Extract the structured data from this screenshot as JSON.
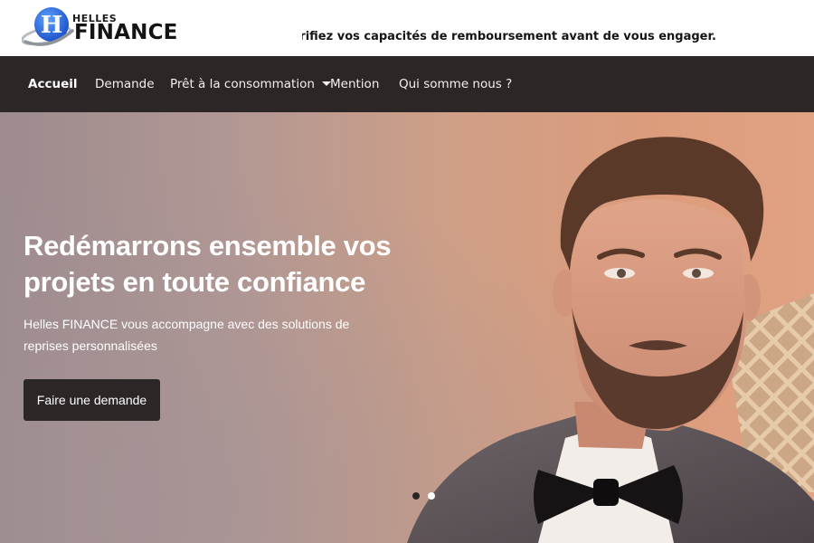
{
  "header": {
    "logo": {
      "letter": "H",
      "small": "HELLES",
      "name": "FINANCE"
    },
    "ticker": "mboursé. Vérifiez vos capacités de remboursement avant de vous engager."
  },
  "nav": {
    "items": [
      {
        "label": "Accueil",
        "active": true
      },
      {
        "label": "Demande"
      },
      {
        "label": "Prêt à la consommation",
        "dropdown": true
      },
      {
        "label": "Mention"
      },
      {
        "label": "Qui somme nous ?"
      }
    ]
  },
  "hero": {
    "title": "Redémarrons ensemble vos projets en toute confiance",
    "subtitle": "Helles FINANCE vous accompagne avec des solutions de reprises personnalisées",
    "cta": "Faire une demande",
    "slides": {
      "count": 2,
      "active": 1
    }
  },
  "colors": {
    "navbar": "#2c2627",
    "button": "#2c2627",
    "logo_blue": "#2a6fe0",
    "hero_left": "#9d8b8e",
    "hero_right": "#e0a283"
  }
}
